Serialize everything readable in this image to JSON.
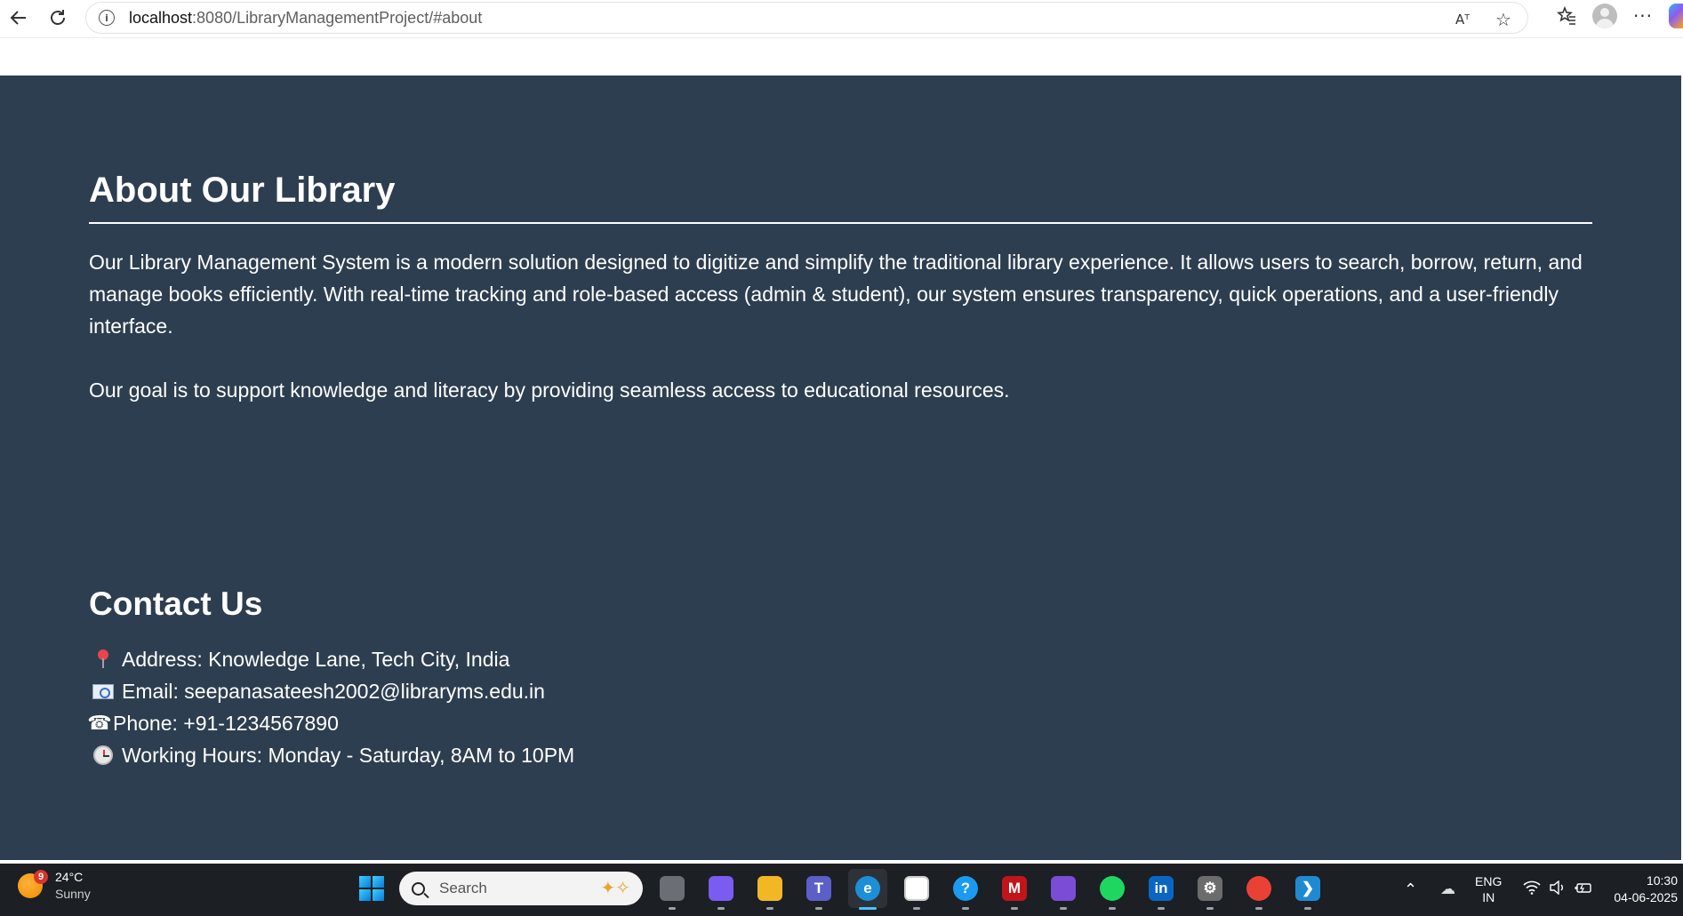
{
  "browser": {
    "url_host": "localhost",
    "url_path": ":8080/LibraryManagementProject/#about",
    "read_aloud_icon": "Aᵀ",
    "icons": [
      "back-icon",
      "reload-icon",
      "info-icon",
      "read-aloud-icon",
      "favorite-star-icon",
      "favorites-icon",
      "profile-avatar",
      "more-icon",
      "copilot-icon"
    ]
  },
  "about": {
    "title": "About Our Library",
    "paragraph1": "Our Library Management System is a modern solution designed to digitize and simplify the traditional library experience. It allows users to search, borrow, return, and manage books efficiently. With real-time tracking and role-based access (admin & student), our system ensures transparency, quick operations, and a user-friendly interface.",
    "paragraph2": "Our goal is to support knowledge and literacy by providing seamless access to educational resources."
  },
  "contact": {
    "title": "Contact Us",
    "items": [
      {
        "icon": "pin-icon",
        "text": "Address: Knowledge Lane, Tech City, India"
      },
      {
        "icon": "email-icon",
        "text": "Email: seepanasateesh2002@libraryms.edu.in"
      },
      {
        "icon": "phone-icon",
        "glyph": "☎",
        "text": "Phone: +91-1234567890"
      },
      {
        "icon": "clock-icon",
        "text": "Working Hours: Monday - Saturday, 8AM to 10PM"
      }
    ]
  },
  "taskbar": {
    "weather": {
      "badge": "9",
      "temp": "24°C",
      "condition": "Sunny"
    },
    "search_label": "Search",
    "apps": [
      {
        "name": "task-view-icon",
        "color": "#6b6f75",
        "letter": ""
      },
      {
        "name": "copilot-app-icon",
        "color": "#7a5cf0",
        "letter": ""
      },
      {
        "name": "file-explorer-icon",
        "color": "#f2b824",
        "letter": ""
      },
      {
        "name": "teams-icon",
        "color": "#5b5fc7",
        "letter": "T"
      },
      {
        "name": "edge-icon",
        "color": "#1b8fd8",
        "letter": "e"
      },
      {
        "name": "microsoft-store-icon",
        "color": "#ffffff",
        "letter": ""
      },
      {
        "name": "help-icon",
        "color": "#1a9bf0",
        "letter": "?"
      },
      {
        "name": "mcafee-icon",
        "color": "#c0161b",
        "letter": "M"
      },
      {
        "name": "m365-icon",
        "color": "#7b4cd6",
        "letter": ""
      },
      {
        "name": "spotify-icon",
        "color": "#1ed760",
        "letter": ""
      },
      {
        "name": "linkedin-icon",
        "color": "#0a66c2",
        "letter": "in"
      },
      {
        "name": "settings-icon",
        "color": "#6c6c6c",
        "letter": "⚙"
      },
      {
        "name": "chrome-icon",
        "color": "#e94235",
        "letter": ""
      },
      {
        "name": "vscode-icon",
        "color": "#1f8ad2",
        "letter": "❯"
      }
    ],
    "lang_line1": "ENG",
    "lang_line2": "IN",
    "time": "10:30",
    "date": "04-06-2025"
  }
}
